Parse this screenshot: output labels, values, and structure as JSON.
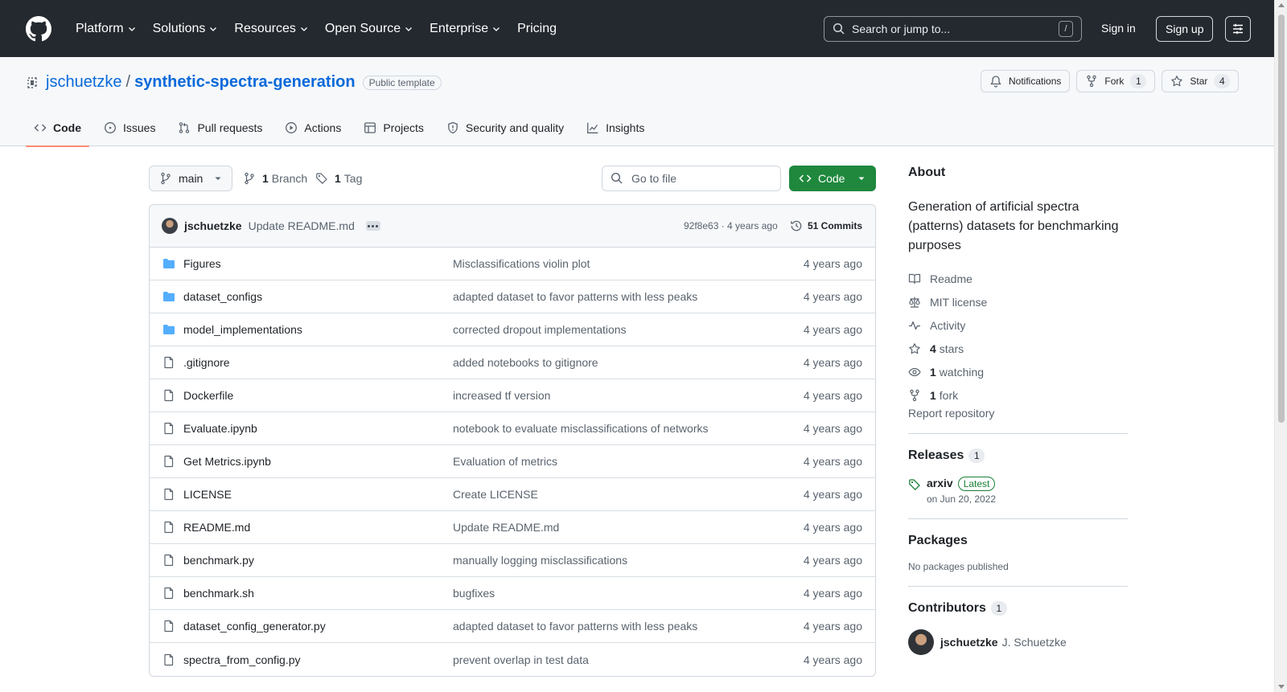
{
  "header": {
    "nav": [
      "Platform",
      "Solutions",
      "Resources",
      "Open Source",
      "Enterprise",
      "Pricing"
    ],
    "search_placeholder": "Search or jump to...",
    "search_key": "/",
    "sign_in": "Sign in",
    "sign_up": "Sign up"
  },
  "repo": {
    "owner": "jschuetzke",
    "separator": "/",
    "name": "synthetic-spectra-generation",
    "visibility": "Public template",
    "notifications_label": "Notifications",
    "fork_label": "Fork",
    "fork_count": "1",
    "star_label": "Star",
    "star_count": "4"
  },
  "tabs": [
    "Code",
    "Issues",
    "Pull requests",
    "Actions",
    "Projects",
    "Security and quality",
    "Insights"
  ],
  "toolbar": {
    "branch": "main",
    "branch_count": "1",
    "branch_label": "Branch",
    "tag_count": "1",
    "tag_label": "Tag",
    "goto_placeholder": "Go to file",
    "code_label": "Code"
  },
  "commit": {
    "author": "jschuetzke",
    "message": "Update README.md",
    "sha_age": "92f8e63 · 4 years ago",
    "commits": "51 Commits"
  },
  "files": [
    {
      "name": "Figures",
      "type": "dir",
      "message": "Misclassifications violin plot",
      "age": "4 years ago"
    },
    {
      "name": "dataset_configs",
      "type": "dir",
      "message": "adapted dataset to favor patterns with less peaks",
      "age": "4 years ago"
    },
    {
      "name": "model_implementations",
      "type": "dir",
      "message": "corrected dropout implementations",
      "age": "4 years ago"
    },
    {
      "name": ".gitignore",
      "type": "file",
      "message": "added notebooks to gitignore",
      "age": "4 years ago"
    },
    {
      "name": "Dockerfile",
      "type": "file",
      "message": "increased tf version",
      "age": "4 years ago"
    },
    {
      "name": "Evaluate.ipynb",
      "type": "file",
      "message": "notebook to evaluate misclassifications of networks",
      "age": "4 years ago"
    },
    {
      "name": "Get Metrics.ipynb",
      "type": "file",
      "message": "Evaluation of metrics",
      "age": "4 years ago"
    },
    {
      "name": "LICENSE",
      "type": "file",
      "message": "Create LICENSE",
      "age": "4 years ago"
    },
    {
      "name": "README.md",
      "type": "file",
      "message": "Update README.md",
      "age": "4 years ago"
    },
    {
      "name": "benchmark.py",
      "type": "file",
      "message": "manually logging misclassifications",
      "age": "4 years ago"
    },
    {
      "name": "benchmark.sh",
      "type": "file",
      "message": "bugfixes",
      "age": "4 years ago"
    },
    {
      "name": "dataset_config_generator.py",
      "type": "file",
      "message": "adapted dataset to favor patterns with less peaks",
      "age": "4 years ago"
    },
    {
      "name": "spectra_from_config.py",
      "type": "file",
      "message": "prevent overlap in test data",
      "age": "4 years ago"
    }
  ],
  "sidebar": {
    "about_title": "About",
    "description": "Generation of artificial spectra (patterns) datasets for benchmarking purposes",
    "readme": "Readme",
    "license": "MIT license",
    "activity": "Activity",
    "stars_count": "4",
    "stars_label": "stars",
    "watching_count": "1",
    "watching_label": "watching",
    "forks_count": "1",
    "forks_label": "fork",
    "report": "Report repository",
    "releases_title": "Releases",
    "releases_count": "1",
    "release_name": "arxiv",
    "release_badge": "Latest",
    "release_date": "on Jun 20, 2022",
    "packages_title": "Packages",
    "packages_empty": "No packages published",
    "contributors_title": "Contributors",
    "contributors_count": "1",
    "contributor_login": "jschuetzke",
    "contributor_name": "J. Schuetzke"
  },
  "colors": {
    "header_bg": "#24292f",
    "link": "#0969da",
    "code_button": "#1f883d",
    "folder_icon": "#54aeff",
    "active_tab_underline": "#fd8c73",
    "latest_badge": "#1a7f37"
  }
}
